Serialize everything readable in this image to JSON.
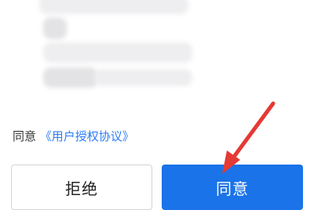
{
  "consent": {
    "prefix": "同意",
    "link_text": "《用户授权协议》"
  },
  "buttons": {
    "reject_label": "拒绝",
    "agree_label": "同意"
  },
  "colors": {
    "accent": "#1a73e8",
    "link": "#2d7cf6",
    "annotation_arrow": "#e53935"
  }
}
